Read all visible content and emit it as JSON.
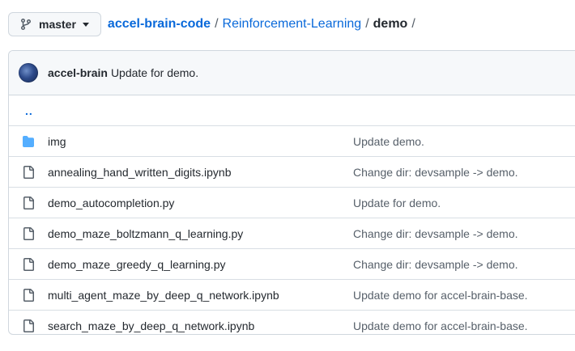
{
  "branch": {
    "label": "master"
  },
  "breadcrumb": {
    "repo": "accel-brain-code",
    "folder": "Reinforcement-Learning",
    "current": "demo",
    "separator": "/"
  },
  "commit": {
    "author": "accel-brain",
    "message": "Update for demo."
  },
  "parent_link": "..",
  "files": [
    {
      "type": "folder",
      "name": "img",
      "message": "Update demo."
    },
    {
      "type": "file",
      "name": "annealing_hand_written_digits.ipynb",
      "message": "Change dir: devsample -> demo."
    },
    {
      "type": "file",
      "name": "demo_autocompletion.py",
      "message": "Update for demo."
    },
    {
      "type": "file",
      "name": "demo_maze_boltzmann_q_learning.py",
      "message": "Change dir: devsample -> demo."
    },
    {
      "type": "file",
      "name": "demo_maze_greedy_q_learning.py",
      "message": "Change dir: devsample -> demo."
    },
    {
      "type": "file",
      "name": "multi_agent_maze_by_deep_q_network.ipynb",
      "message": "Update demo for accel-brain-base."
    },
    {
      "type": "file",
      "name": "search_maze_by_deep_q_network.ipynb",
      "message": "Update demo for accel-brain-base."
    }
  ],
  "colors": {
    "link": "#0969da",
    "folder_icon": "#54aeff",
    "file_icon": "#57606a"
  }
}
